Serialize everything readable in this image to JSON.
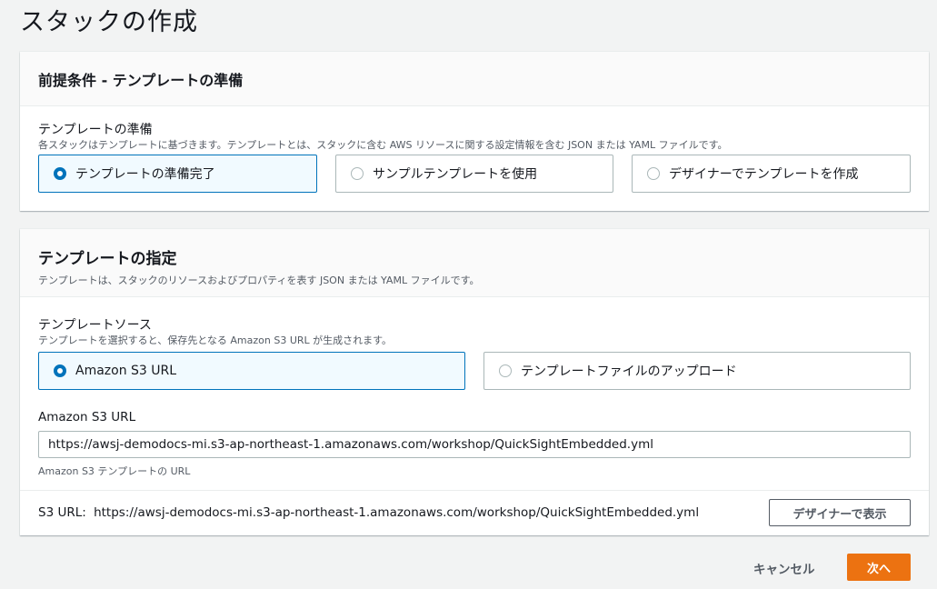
{
  "page": {
    "title": "スタックの作成"
  },
  "prerequisite": {
    "title": "前提条件 - テンプレートの準備",
    "field_label": "テンプレートの準備",
    "field_desc": "各スタックはテンプレートに基づきます。テンプレートとは、スタックに含む AWS リソースに関する設定情報を含む JSON または YAML ファイルです。",
    "options": [
      {
        "label": "テンプレートの準備完了",
        "selected": true
      },
      {
        "label": "サンプルテンプレートを使用",
        "selected": false
      },
      {
        "label": "デザイナーでテンプレートを作成",
        "selected": false
      }
    ]
  },
  "specify": {
    "title": "テンプレートの指定",
    "desc": "テンプレートは、スタックのリソースおよびプロパティを表す JSON または YAML ファイルです。",
    "source_label": "テンプレートソース",
    "source_desc": "テンプレートを選択すると、保存先となる Amazon S3 URL が生成されます。",
    "source_options": [
      {
        "label": "Amazon S3 URL",
        "selected": true
      },
      {
        "label": "テンプレートファイルのアップロード",
        "selected": false
      }
    ],
    "url_label": "Amazon S3 URL",
    "url_value": "https://awsj-demodocs-mi.s3-ap-northeast-1.amazonaws.com/workshop/QuickSightEmbedded.yml",
    "url_hint": "Amazon S3 テンプレートの URL",
    "s3_url_prefix": "S3 URL:",
    "s3_url_value": "https://awsj-demodocs-mi.s3-ap-northeast-1.amazonaws.com/workshop/QuickSightEmbedded.yml",
    "designer_button": "デザイナーで表示"
  },
  "footer": {
    "cancel": "キャンセル",
    "next": "次へ"
  },
  "colors": {
    "accent": "#0073bb",
    "primary_button": "#ec7211"
  }
}
